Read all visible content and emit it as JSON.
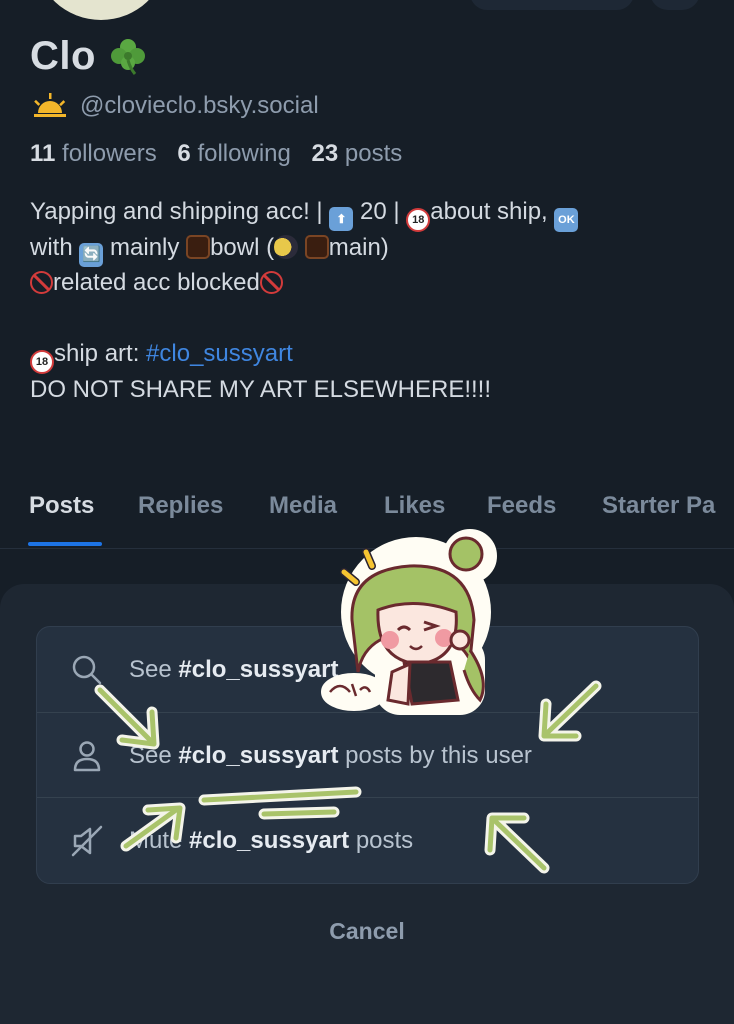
{
  "profile": {
    "display_name": "Clo",
    "name_emoji": "clover-icon",
    "status_emoji": "sun-icon",
    "handle": "@clovieclo.bsky.social",
    "followers_count": "11",
    "followers_label": "followers",
    "following_count": "6",
    "following_label": "following",
    "posts_count": "23",
    "posts_label": "posts"
  },
  "bio": {
    "l1_a": "Yapping and shipping acc! |",
    "l1_b": "20 |",
    "l1_c": "about ship,",
    "l2_a": "with",
    "l2_b": "mainly",
    "l2_c": "bowl (",
    "l2_d": "main)",
    "l3_a": "related acc blocked",
    "l4_a": "ship art:",
    "l4_hashtag": "#clo_sussyart",
    "l5": "DO NOT SHARE MY ART ELSEWHERE!!!!",
    "emoji_up": "⬆",
    "emoji_ok": "OK",
    "emoji_cycle": "🔄",
    "emoji_18": "18"
  },
  "tabs": [
    {
      "label": "Posts",
      "active": true
    },
    {
      "label": "Replies"
    },
    {
      "label": "Media"
    },
    {
      "label": "Likes"
    },
    {
      "label": "Feeds"
    },
    {
      "label": "Starter Pa"
    }
  ],
  "sheet": {
    "items": [
      {
        "prefix": "See",
        "hashtag": "#clo_sussyart",
        "suffix": "",
        "icon": "search-icon"
      },
      {
        "prefix": "See",
        "hashtag": "#clo_sussyart",
        "suffix": "posts by this user",
        "icon": "person-icon"
      },
      {
        "prefix": "Mute",
        "hashtag": "#clo_sussyart",
        "suffix": "posts",
        "icon": "mute-icon"
      }
    ],
    "cancel": "Cancel"
  },
  "sticker": {
    "handwritten_text": "hehe"
  },
  "colors": {
    "background": "#161e27",
    "accent": "#1d74e6",
    "hashtag": "#3f86e0",
    "sheet": "#1e2732",
    "menu": "#253140",
    "arrow": "#a9c36a"
  }
}
